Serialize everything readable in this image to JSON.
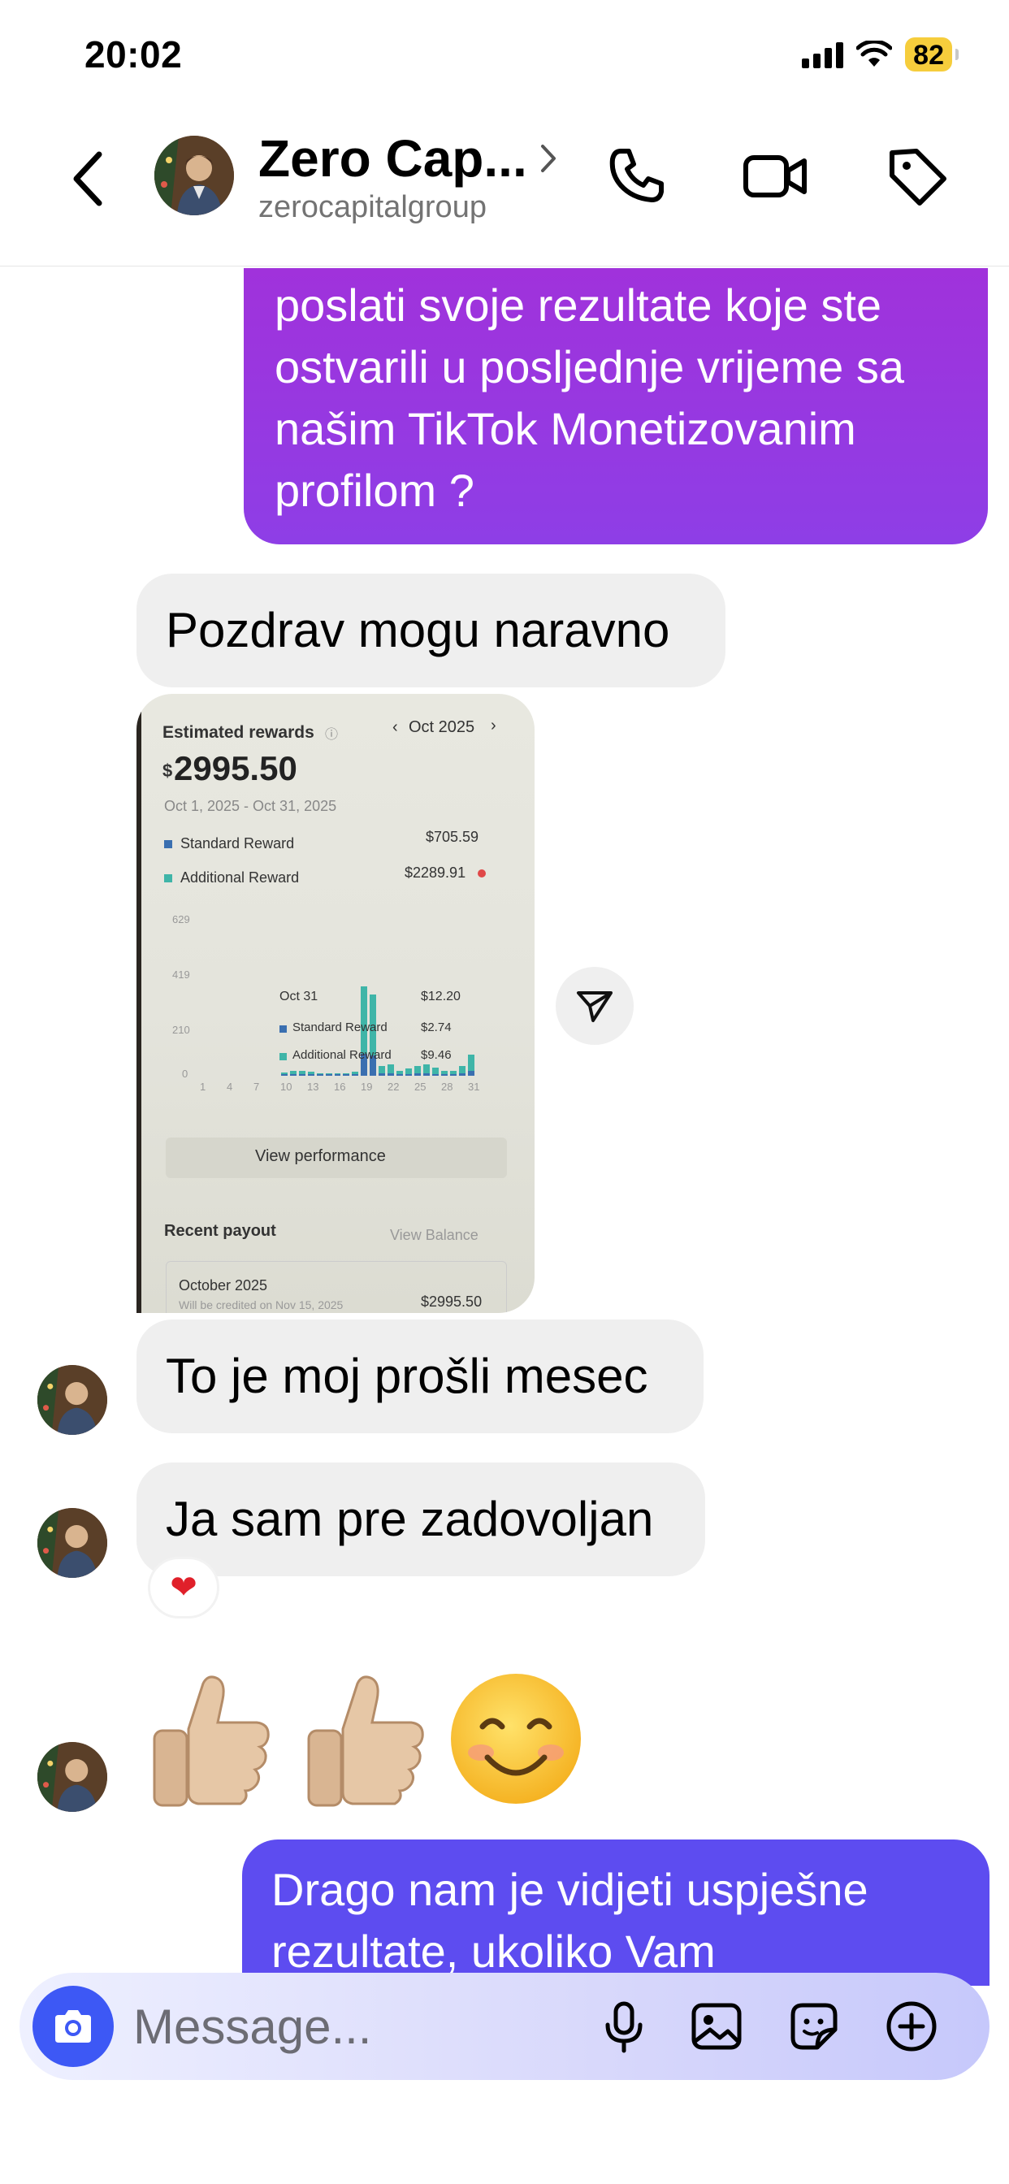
{
  "status": {
    "time": "20:02",
    "battery": "82"
  },
  "header": {
    "name": "Zero Cap...",
    "username": "zerocapitalgroup"
  },
  "messages": {
    "outgoing_1": "poslati svoje rezultate koje ste ostvarili u posljednje vrijeme sa našim TikTok Monetizovanim profilom ?",
    "incoming_1": "Pozdrav mogu naravno",
    "incoming_2": "To je moj prošli mesec",
    "incoming_3": "Ja sam pre zadovoljan",
    "reaction": "❤",
    "outgoing_2": "Drago nam je vidjeti uspješne rezultate, ukoliko Vam"
  },
  "screenshot": {
    "title": "Estimated rewards",
    "month": "Oct 2025",
    "total_currency": "$",
    "total": "2995.50",
    "range": "Oct 1, 2025 - Oct 31, 2025",
    "standard_label": "Standard Reward",
    "standard_value": "$705.59",
    "additional_label": "Additional Reward",
    "additional_value": "$2289.91",
    "y_ticks": [
      "629",
      "419",
      "210",
      "0"
    ],
    "x_ticks": [
      "1",
      "4",
      "7",
      "10",
      "13",
      "16",
      "19",
      "22",
      "25",
      "28",
      "31"
    ],
    "tooltip": {
      "date": "Oct 31",
      "total": "$12.20",
      "standard_label": "Standard Reward",
      "standard_value": "$2.74",
      "additional_label": "Additional Reward",
      "additional_value": "$9.46"
    },
    "view_performance": "View performance",
    "recent_payout": "Recent payout",
    "view_balance": "View Balance",
    "payout_month": "October 2025",
    "payout_note": "Will be credited on Nov 15, 2025",
    "payout_amount": "$2995.50",
    "colors": {
      "standard": "#3a6fb0",
      "additional": "#3fb5a8"
    }
  },
  "composer": {
    "placeholder": "Message..."
  },
  "colors": {
    "outgoing_gradient_top": "#a032db",
    "outgoing_2": "#5d4cf0",
    "camera_button": "#3d58f5",
    "battery": "#f6cd3c"
  }
}
